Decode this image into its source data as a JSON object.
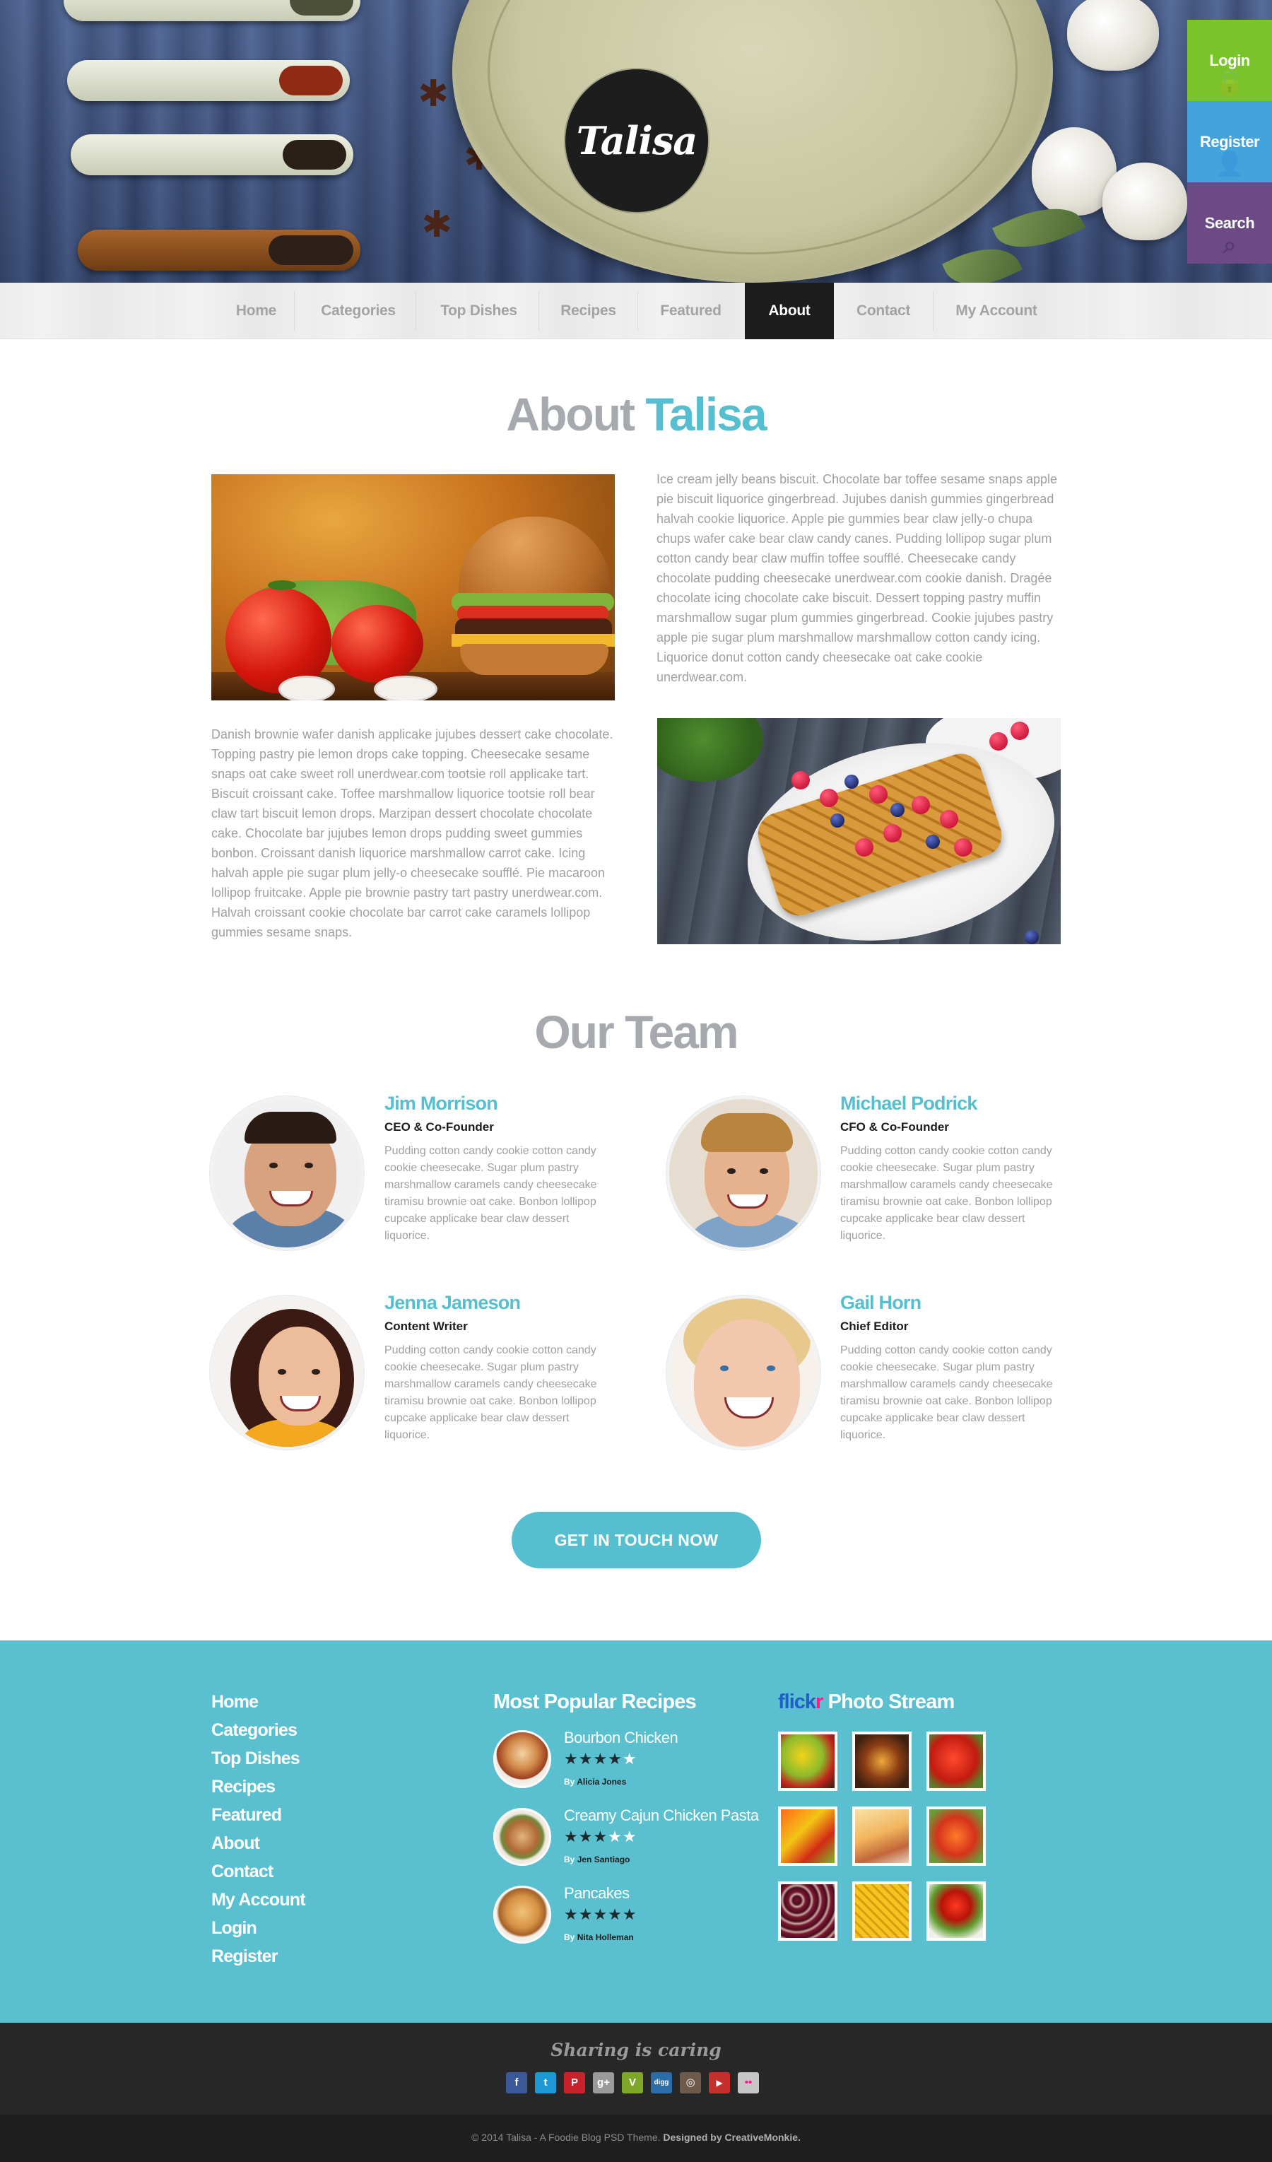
{
  "brand": {
    "logo_text": "Talisa"
  },
  "side_actions": [
    {
      "label": "Login",
      "color": "#78c42a",
      "icon": "lock-icon"
    },
    {
      "label": "Register",
      "color": "#43a3dc",
      "icon": "user-icon"
    },
    {
      "label": "Search",
      "color": "#6d4a86",
      "icon": "search-icon"
    }
  ],
  "nav": {
    "items": [
      "Home",
      "Categories",
      "Top Dishes",
      "Recipes",
      "Featured",
      "About",
      "Contact",
      "My Account"
    ],
    "active": "About"
  },
  "about": {
    "title_main": "About",
    "title_accent": "Talisa",
    "paragraph_1": "Ice cream jelly beans biscuit. Chocolate bar toffee sesame snaps apple pie biscuit liquorice gingerbread. Jujubes danish gummies gingerbread halvah cookie liquorice. Apple pie gummies bear claw jelly-o chupa chups wafer cake bear claw candy canes. Pudding lollipop sugar plum cotton candy bear claw muffin toffee soufflé. Cheesecake candy chocolate pudding cheesecake unerdwear.com cookie danish. Dragée chocolate icing chocolate cake biscuit. Dessert topping pastry muffin marshmallow sugar plum gummies gingerbread. Cookie jujubes pastry apple pie sugar plum marshmallow marshmallow cotton candy icing. Liquorice donut cotton candy cheesecake oat cake cookie unerdwear.com.",
    "paragraph_2": "Danish brownie wafer danish applicake jujubes dessert cake chocolate. Topping pastry pie lemon drops cake topping. Cheesecake sesame snaps oat cake sweet roll unerdwear.com tootsie roll applicake tart. Biscuit croissant cake. Toffee marshmallow liquorice tootsie roll bear claw tart biscuit lemon drops. Marzipan dessert chocolate chocolate cake. Chocolate bar jujubes lemon drops pudding sweet gummies bonbon. Croissant danish liquorice marshmallow carrot cake. Icing halvah apple pie sugar plum jelly-o cheesecake soufflé. Pie macaroon lollipop fruitcake. Apple pie brownie pastry tart pastry unerdwear.com. Halvah croissant cookie chocolate bar carrot cake caramels lollipop gummies sesame snaps."
  },
  "team": {
    "title": "Our Team",
    "members": [
      {
        "name": "Jim Morrison",
        "role": "CEO & Co-Founder",
        "desc": "Pudding cotton candy cookie cotton candy cookie cheesecake. Sugar plum pastry marshmallow caramels candy cheesecake tiramisu brownie oat cake. Bonbon lollipop cupcake applicake bear claw dessert liquorice."
      },
      {
        "name": "Michael Podrick",
        "role": "CFO & Co-Founder",
        "desc": "Pudding cotton candy cookie cotton candy cookie cheesecake. Sugar plum pastry marshmallow caramels candy cheesecake tiramisu brownie oat cake. Bonbon lollipop cupcake applicake bear claw dessert liquorice."
      },
      {
        "name": "Jenna Jameson",
        "role": "Content Writer",
        "desc": "Pudding cotton candy cookie cotton candy cookie cheesecake. Sugar plum pastry marshmallow caramels candy cheesecake tiramisu brownie oat cake. Bonbon lollipop cupcake applicake bear claw dessert liquorice."
      },
      {
        "name": "Gail Horn",
        "role": "Chief Editor",
        "desc": "Pudding cotton candy cookie cotton candy cookie cheesecake. Sugar plum pastry marshmallow caramels candy cheesecake tiramisu brownie oat cake. Bonbon lollipop cupcake applicake bear claw dessert liquorice."
      }
    ],
    "cta_label": "GET IN TOUCH NOW"
  },
  "footer": {
    "links": [
      "Home",
      "Categories",
      "Top Dishes",
      "Recipes",
      "Featured",
      "About",
      "Contact",
      "My Account",
      "Login",
      "Register"
    ],
    "popular_heading": "Most Popular Recipes",
    "recipes": [
      {
        "title": "Bourbon Chicken",
        "rating": 4,
        "by_label": "By",
        "author": "Alicia Jones"
      },
      {
        "title": "Creamy Cajun Chicken Pasta",
        "rating": 3,
        "by_label": "By",
        "author": "Jen Santiago"
      },
      {
        "title": "Pancakes",
        "rating": 5,
        "by_label": "By",
        "author": "Nita Holleman"
      }
    ],
    "flickr": {
      "logo_a": "flick",
      "logo_b": "r",
      "heading": "Photo Stream"
    }
  },
  "share": {
    "title": "Sharing is caring",
    "icons": [
      {
        "name": "facebook-icon",
        "glyph": "f",
        "color": "#3b5998"
      },
      {
        "name": "twitter-icon",
        "glyph": "t",
        "color": "#1d9ad6"
      },
      {
        "name": "pinterest-icon",
        "glyph": "P",
        "color": "#c8232c"
      },
      {
        "name": "google-plus-icon",
        "glyph": "g+",
        "color": "#9a9a9a"
      },
      {
        "name": "vimeo-icon",
        "glyph": "V",
        "color": "#7fa82a"
      },
      {
        "name": "digg-icon",
        "glyph": "digg",
        "color": "#2a6da9"
      },
      {
        "name": "instagram-icon",
        "glyph": "◎",
        "color": "#6e5a4a"
      },
      {
        "name": "youtube-icon",
        "glyph": "▶",
        "color": "#c4302b"
      },
      {
        "name": "flickr-icon",
        "glyph": "••",
        "color": "#c6c6c6"
      }
    ]
  },
  "copyright": {
    "text": "© 2014 Talisa - A Foodie Blog PSD Theme.",
    "credit": "Designed by CreativeMonkie."
  }
}
